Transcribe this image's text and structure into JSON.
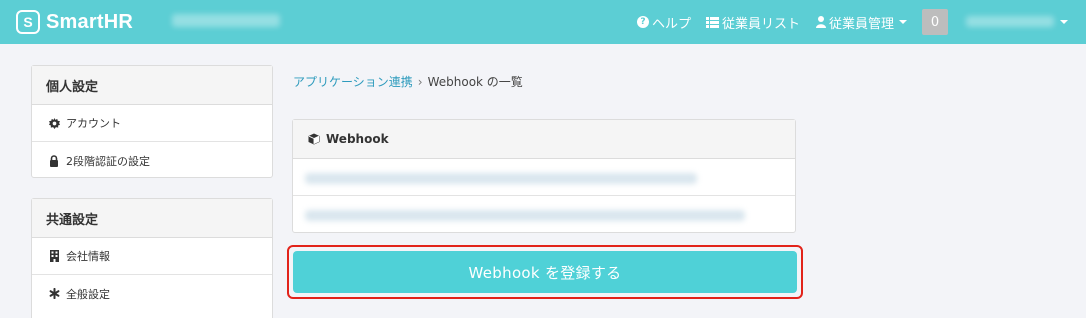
{
  "header": {
    "logo_mark": "S",
    "logo_text": "SmartHR",
    "nav": {
      "help": "ヘルプ",
      "employee_list": "従業員リスト",
      "employee_manage": "従業員管理"
    },
    "notification_count": "0"
  },
  "sidebar": {
    "personal": {
      "title": "個人設定",
      "items": [
        {
          "label": "アカウント",
          "icon": "gear-icon"
        },
        {
          "label": "2段階認証の設定",
          "icon": "lock-icon"
        }
      ]
    },
    "common": {
      "title": "共通設定",
      "items": [
        {
          "label": "会社情報",
          "icon": "building-icon"
        },
        {
          "label": "全般設定",
          "icon": "asterisk-icon"
        }
      ]
    }
  },
  "breadcrumb": {
    "parent": "アプリケーション連携",
    "current": "Webhook の一覧"
  },
  "webhook_panel": {
    "title": "Webhook",
    "icon": "cube-icon"
  },
  "register_button": "Webhook を登録する",
  "colors": {
    "header": "#5cced4",
    "button": "#4fd1d7",
    "link": "#2e9bbd",
    "highlight": "#e2231a"
  }
}
